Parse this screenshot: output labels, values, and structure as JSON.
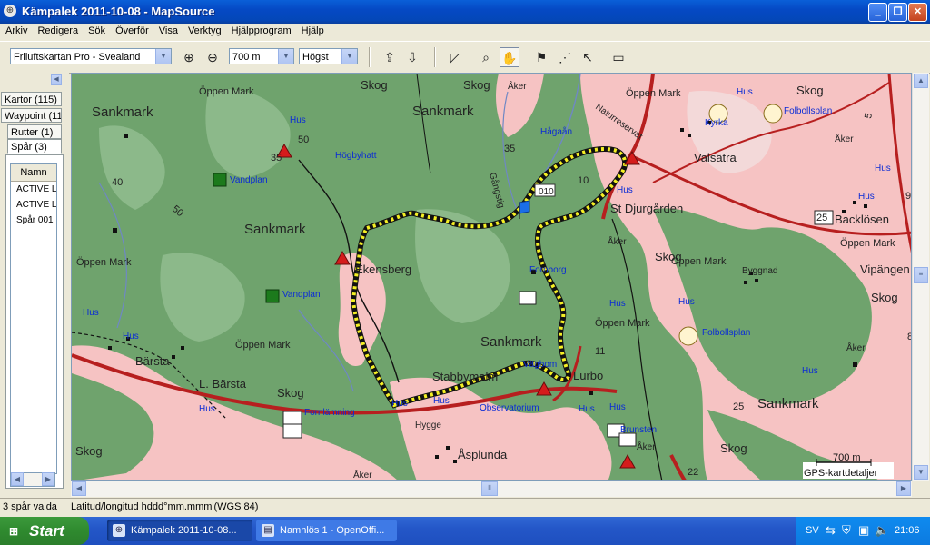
{
  "window": {
    "title": "Kämpalek 2011-10-08 - MapSource",
    "app_icon": "mapsource-icon"
  },
  "menu": [
    "Arkiv",
    "Redigera",
    "Sök",
    "Överför",
    "Visa",
    "Verktyg",
    "Hjälpprogram",
    "Hjälp"
  ],
  "toolbar": {
    "map_product": "Friluftskartan Pro - Svealand",
    "zoom_level": "700 m",
    "detail_level": "Högst"
  },
  "tabs": [
    "Kartor (115)",
    "Waypoint (11",
    "Rutter (1)",
    "Spår (3)"
  ],
  "list": {
    "header": "Namn",
    "rows": [
      "ACTIVE L",
      "ACTIVE L",
      "Spår 001"
    ]
  },
  "map": {
    "labels": {
      "sankmark": "Sankmark",
      "oppen_mark": "Öppen Mark",
      "skog": "Skog",
      "hus": "Hus",
      "aker": "Åker",
      "vandplan": "Vandplan",
      "hogbyhatt": "Högbyhatt",
      "hagaan": "Hågaån",
      "gangstig": "Gångstig",
      "naturreservat": "Naturreservat",
      "kyrka": "Kyrka",
      "folbollsplan": "Folbollsplan",
      "valsatra": "Valsätra",
      "st_djurgarden": "St Djurgården",
      "backlosen": "Backlösen",
      "byggnad": "Byggnad",
      "vipangen": "Vipängen",
      "ekensberg": "Ekensberg",
      "fornborg": "Fornborg",
      "barsta": "Bärsta",
      "l_barsta": "L. Bärsta",
      "stabbymalm": "Stabbymalm",
      "vagbom": "Vägbom",
      "lurbo": "Lurbo",
      "fornlamning": "Fornlämning",
      "hygge": "Hygge",
      "observatorium": "Observatorium",
      "asplunda": "Åsplunda",
      "brunsten": "Brunsten",
      "waypoint_label": "010"
    },
    "numbers": [
      "50",
      "35",
      "40",
      "50",
      "35",
      "10",
      "11",
      "25",
      "22",
      "25",
      "9",
      "8",
      "5"
    ],
    "scale_label": "700 m",
    "details_label": "GPS-kartdetaljer",
    "colors": {
      "forest": "#6fa36d",
      "open_land": "#f6c3c3",
      "road": "#b71f1f",
      "track": "#f5f024",
      "water": "#6f88c4"
    }
  },
  "status": {
    "selection": "3 spår valda",
    "coord_format": "Latitud/longitud hddd°mm.mmm'(WGS 84)"
  },
  "taskbar": {
    "start": "Start",
    "items": [
      "Kämpalek 2011-10-08...",
      "Namnlös 1 - OpenOffi..."
    ],
    "language": "SV",
    "clock": "21:06"
  }
}
